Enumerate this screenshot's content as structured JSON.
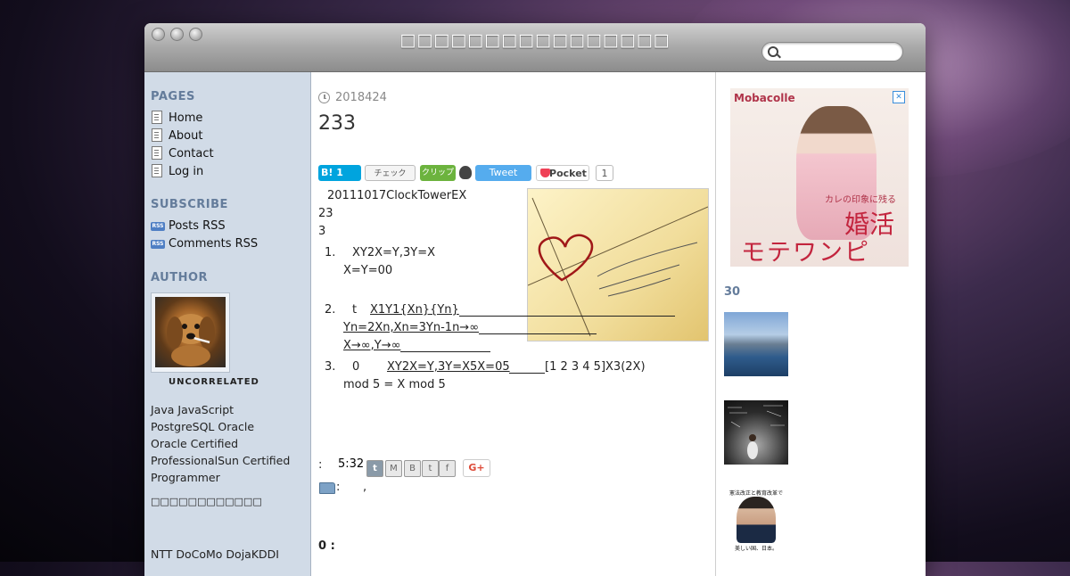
{
  "window": {
    "site_title": "□□□□□□□□□□□□□□□□",
    "search_placeholder": ""
  },
  "sidebar": {
    "pages_heading": "PAGES",
    "pages": [
      "Home",
      "About",
      "Contact",
      "Log in"
    ],
    "subscribe_heading": "SUBSCRIBE",
    "feeds": [
      "Posts RSS",
      "Comments RSS"
    ],
    "rss_badge": "RSS",
    "author_heading": "AUTHOR",
    "author_name": "UNCORRELATED",
    "bio_lines": [
      "Java JavaScript",
      "PostgreSQL Oracle",
      "Oracle Certified",
      "ProfessionalSun Certified",
      "Programmer"
    ],
    "bio_jp": "□□□□□□□□□□□□",
    "bio_tail": "NTT DoCoMo DojaKDDI"
  },
  "post": {
    "date": "2018424",
    "title": "233",
    "share": {
      "hatena": "B! 1",
      "check": "チェック",
      "clip": "クリップ",
      "tweet": "Tweet",
      "pocket": "Pocket",
      "pocket_count": "1"
    },
    "intro": "20111017ClockTowerEX",
    "line2": "23",
    "line3": "3",
    "items": [
      {
        "num": "1.",
        "a": "XY2X=Y,3Y=X",
        "b": "X=Y=00"
      },
      {
        "num": "2.",
        "lead": "t",
        "a": "X1Y1{Xn}{Yn}",
        "b": "Yn=2Xn,Xn=3Yn-1n→∞",
        "c": "X→∞,Y→∞"
      },
      {
        "num": "3.",
        "lead": "0",
        "a": "XY2X=Y,3Y=X5X=05",
        "a2": "[1 2 3 4 5]X3(2X)",
        "b": "mod 5 = X mod 5"
      }
    ],
    "time_label": ":",
    "time": "5:32",
    "category_label": ":",
    "category_sep": ",",
    "comments": "0 :",
    "gplus": "G+"
  },
  "right": {
    "ad": {
      "brand": "Mobacolle",
      "tag": "カレの印象に残る",
      "big1": "婚活",
      "big2": "モテワンピ"
    },
    "section_heading": "30",
    "thumb3_caption_top": "憲法改正と教育改革で",
    "thumb3_caption_bottom": "美しい国、日本。"
  },
  "colors": {
    "sidebar_bg": "#d1dbe7",
    "heading": "#647c9b",
    "tweet": "#55acee",
    "pocket": "#ef4056",
    "hatena": "#00a4de"
  }
}
